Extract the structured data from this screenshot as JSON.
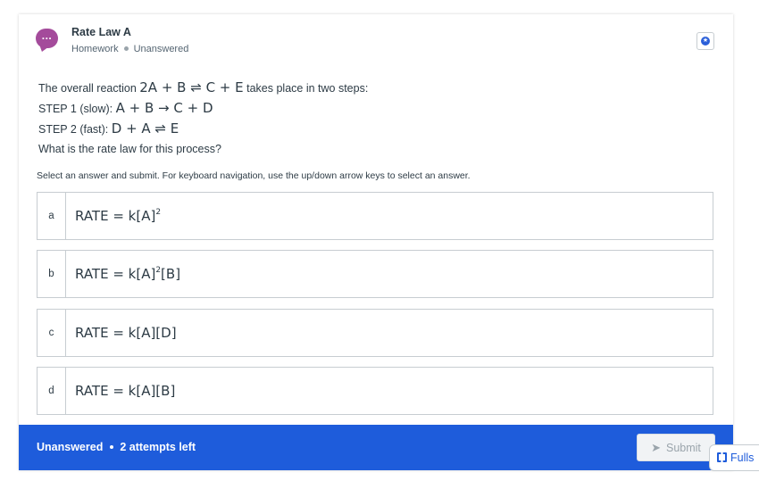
{
  "header": {
    "avatar_glyph": "...",
    "title": "Rate Law A",
    "type": "Homework",
    "status": "Unanswered",
    "flag_icon": "star-badge-icon"
  },
  "question": {
    "line1_pre": "The overall reaction ",
    "line1_eq": "2A + B ⇌ C + E",
    "line1_post": " takes place in two steps:",
    "step1_label": "STEP 1 (slow): ",
    "step1_eq": "A + B → C + D",
    "step2_label": "STEP 2 (fast): ",
    "step2_eq": "D + A ⇌ E",
    "prompt": "What is the rate law for this process?"
  },
  "instructions": "Select an answer and submit. For keyboard navigation, use the up/down arrow keys to select an answer.",
  "options": [
    {
      "letter": "a",
      "text": "RATE = k[A]",
      "sup1": "2",
      "tail": ""
    },
    {
      "letter": "b",
      "text": "RATE = k[A]",
      "sup1": "2",
      "tail": "[B]"
    },
    {
      "letter": "c",
      "text": "RATE = k[A][D]",
      "sup1": "",
      "tail": ""
    },
    {
      "letter": "d",
      "text": "RATE = k[A][B]",
      "sup1": "",
      "tail": ""
    }
  ],
  "footer": {
    "status": "Unanswered",
    "attempts": "2 attempts left",
    "submit_label": "Submit",
    "submit_icon": "paper-plane-icon"
  },
  "fullscreen_label": "Fulls",
  "colors": {
    "accent": "#1e5cdb",
    "avatar": "#a44b9b",
    "text": "#2d3b45",
    "border": "#c7cdd1"
  }
}
